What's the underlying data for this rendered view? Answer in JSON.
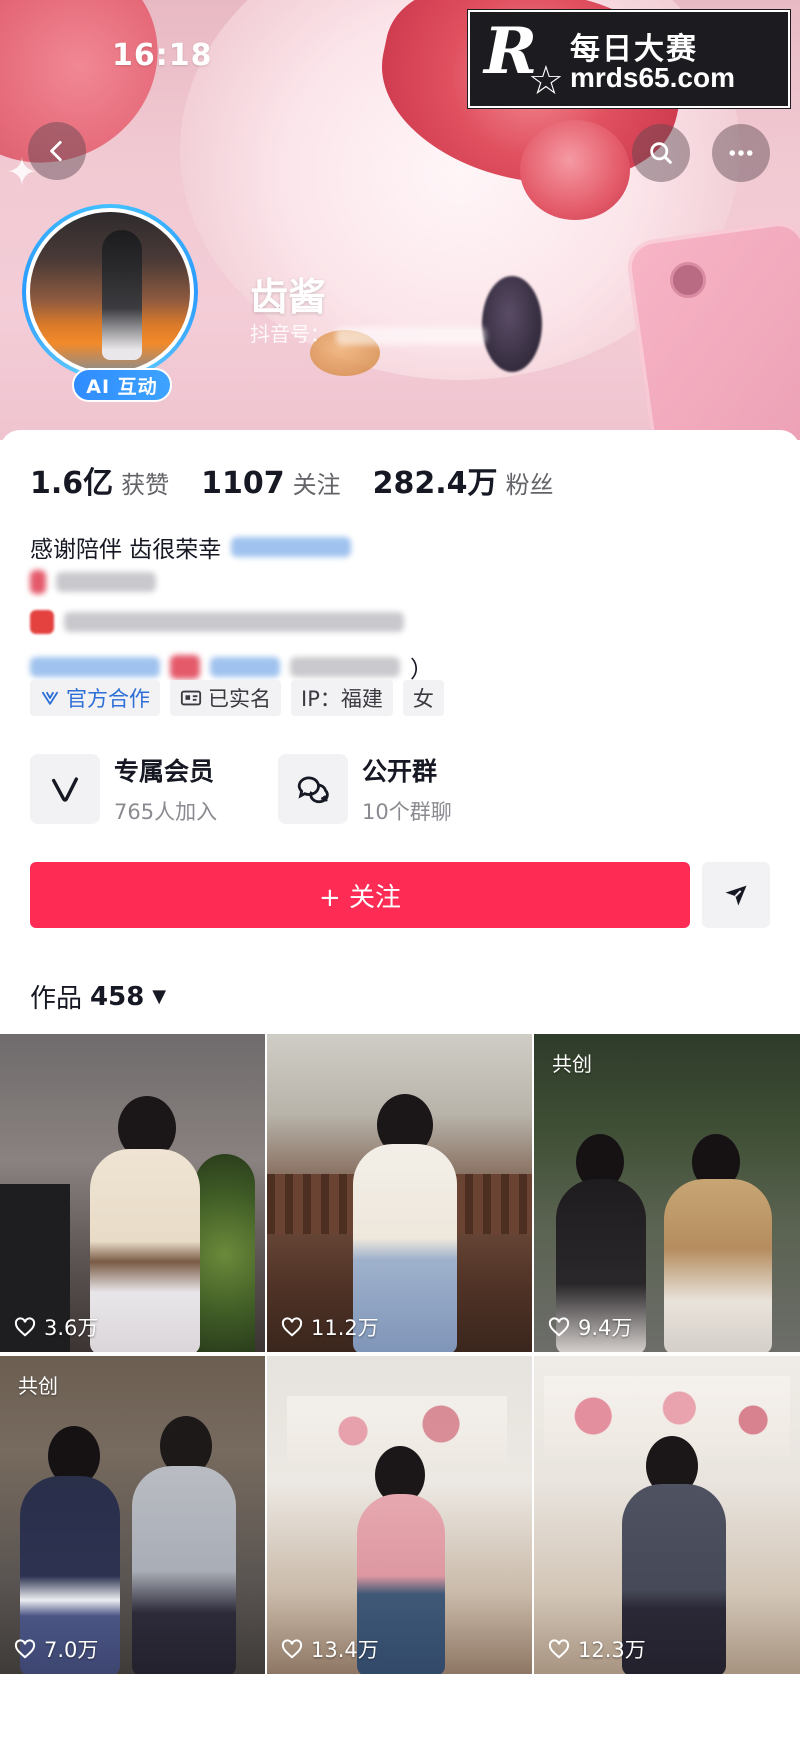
{
  "status_bar": {
    "time": "16:18"
  },
  "watermark": {
    "logo_letter": "R",
    "logo_small": "每日大赛",
    "title": "每日大赛",
    "url": "mrds65.com"
  },
  "icons": {
    "back": "chevron-left-icon",
    "search": "search-icon",
    "more": "more-horizontal-icon",
    "official": "official-check-icon",
    "id_card": "id-card-icon",
    "member": "v-membership-icon",
    "group": "group-chat-icon",
    "share": "send-icon",
    "heart": "heart-outline-icon"
  },
  "profile": {
    "ai_badge": "AI 互动",
    "nickname": "齿酱",
    "douyin_id_label": "抖音号："
  },
  "stats": [
    {
      "num": "1.6亿",
      "label": "获赞"
    },
    {
      "num": "1107",
      "label": "关注"
    },
    {
      "num": "282.4万",
      "label": "粉丝"
    }
  ],
  "bio": {
    "line1": "感谢陪伴 齿很荣幸",
    "line4_end": "）"
  },
  "tags": [
    "官方合作",
    "已实名",
    "IP：福建",
    "女"
  ],
  "features": [
    {
      "title": "专属会员",
      "sub": "765人加入"
    },
    {
      "title": "公开群",
      "sub": "10个群聊"
    }
  ],
  "follow_label": "+ 关注",
  "works": {
    "label": "作品",
    "count": "458"
  },
  "videos": [
    {
      "likes": "3.6万",
      "cocreate": ""
    },
    {
      "likes": "11.2万",
      "cocreate": ""
    },
    {
      "likes": "9.4万",
      "cocreate": "共创"
    },
    {
      "likes": "7.0万",
      "cocreate": "共创"
    },
    {
      "likes": "13.4万",
      "cocreate": ""
    },
    {
      "likes": "12.3万",
      "cocreate": ""
    }
  ],
  "colors": {
    "accent": "#fe2c55",
    "ai_badge": "#2f8cff",
    "official_blue": "#2d6fd6"
  }
}
